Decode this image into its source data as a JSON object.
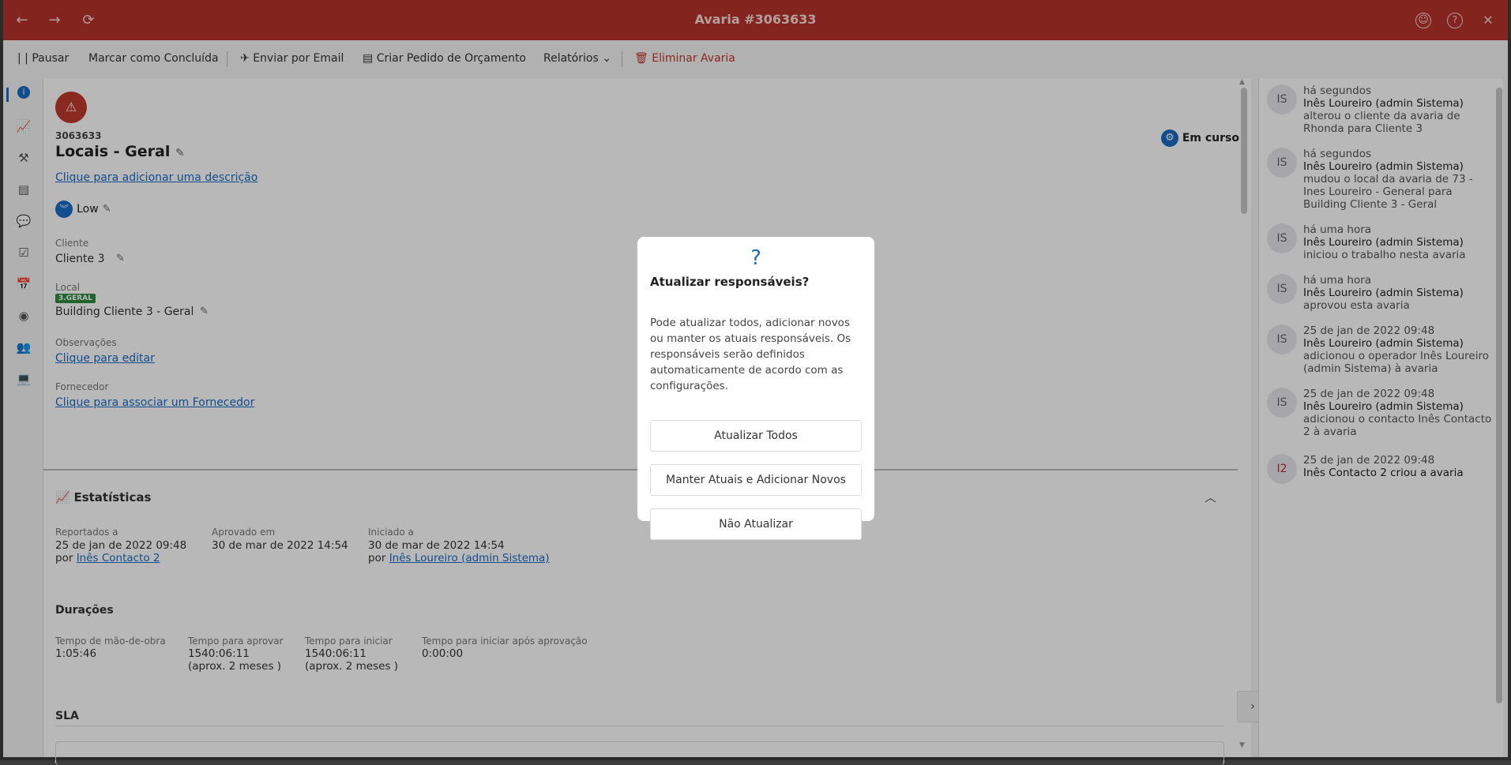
{
  "window": {
    "title": "Avaria #3063633"
  },
  "titlebar": {
    "back": "←",
    "forward": "→",
    "refresh": "⟳",
    "feedback": "☺",
    "help": "?",
    "close": "✕"
  },
  "toolbar": {
    "pause": "| | Pausar",
    "mark_done": "Marcar como Concluída",
    "email": "Enviar por Email",
    "quote": "Criar Pedido de Orçamento",
    "reports": "Relatórios",
    "delete": "Eliminar Avaria"
  },
  "ticket": {
    "id": "3063633",
    "title": "Locais - Geral",
    "add_description": "Clique para adicionar uma descrição",
    "priority": "Low",
    "status": "Em curso",
    "client_label": "Cliente",
    "client": "Cliente 3",
    "location_label": "Local",
    "location_badge": "3.GERAL",
    "location": "Building Cliente 3 - Geral",
    "notes_label": "Observações",
    "notes_link": "Clique para editar",
    "supplier_label": "Fornecedor",
    "supplier_link": "Clique para associar um Fornecedor"
  },
  "stats": {
    "title": "Estatísticas",
    "reported_label": "Reportados a",
    "reported_date": "25 de jan de 2022 09:48",
    "reported_by_prefix": "por",
    "reported_by": "Inês Contacto 2",
    "approved_label": "Aprovado em",
    "approved_date": "30 de mar de 2022 14:54",
    "started_label": "Iniciado a",
    "started_date": "30 de mar de 2022 14:54",
    "started_by_prefix": "por",
    "started_by": "Inês Loureiro (admin Sistema)"
  },
  "durations": {
    "title": "Durações",
    "labor_label": "Tempo de mão-de-obra",
    "labor": "1:05:46",
    "approve_label": "Tempo para aprovar",
    "approve": "1540:06:11",
    "approve_approx": "(aprox. 2 meses )",
    "start_label": "Tempo para iniciar",
    "start": "1540:06:11",
    "start_approx": "(aprox. 2 meses )",
    "start_after_label": "Tempo para iniciar após aprovação",
    "start_after": "0:00:00"
  },
  "sla": {
    "title": "SLA"
  },
  "activity": [
    {
      "avatar": "IS",
      "time": "há segundos",
      "user": "Inês Loureiro (admin Sistema)",
      "l3": "alterou o cliente da avaria de",
      "l4": "Rhonda para Cliente 3"
    },
    {
      "avatar": "IS",
      "time": "há segundos",
      "user": "Inês Loureiro (admin Sistema)",
      "l3": "mudou o local da avaria de 73 -",
      "l4": "Ines Loureiro - General para",
      "l5": "Building Cliente 3 - Geral"
    },
    {
      "avatar": "IS",
      "time": "há uma hora",
      "user": "Inês Loureiro (admin Sistema)",
      "l3": "iniciou o trabalho nesta avaria"
    },
    {
      "avatar": "IS",
      "time": "há uma hora",
      "user": "Inês Loureiro (admin Sistema)",
      "l3": "aprovou esta avaria"
    },
    {
      "avatar": "IS",
      "time": "25 de jan de 2022 09:48",
      "user": "Inês Loureiro (admin Sistema)",
      "l3": "adicionou o operador Inês Loureiro",
      "l4": "(admin Sistema) à avaria"
    },
    {
      "avatar": "IS",
      "time": "25 de jan de 2022 09:48",
      "user": "Inês Loureiro (admin Sistema)",
      "l3": "adicionou o contacto Inês Contacto",
      "l4": "2 à avaria"
    },
    {
      "avatar": "I2",
      "time": "25 de jan de 2022 09:48",
      "user": "Inês Contacto 2 criou a avaria"
    }
  ],
  "modal": {
    "icon": "?",
    "title": "Atualizar responsáveis?",
    "body": "Pode atualizar todos, adicionar novos ou manter os atuais responsáveis. Os responsáveis serão definidos automaticamente de acordo com as configurações.",
    "btn_all": "Atualizar Todos",
    "btn_keep": "Manter Atuais e Adicionar Novos",
    "btn_none": "Não Atualizar"
  },
  "colors": {
    "brand": "#b8322a",
    "link": "#1a6cc4",
    "priority": "#1a6cc4",
    "badge": "#2e8b3e"
  }
}
